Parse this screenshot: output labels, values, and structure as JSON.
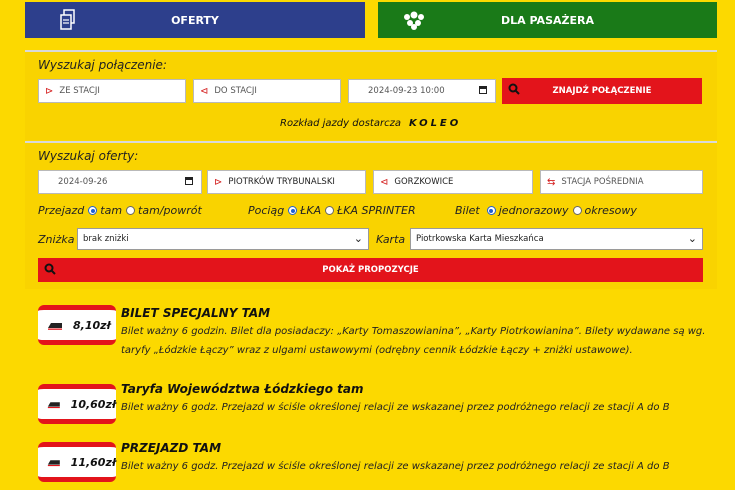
{
  "tabs": [
    {
      "label": "OFERTY",
      "icon": "document-icon"
    },
    {
      "label": "DLA PASAŻERA",
      "icon": "people-group-icon"
    }
  ],
  "connection": {
    "title": "Wyszukaj połączenie:",
    "from_placeholder": "ZE STACJI",
    "to_placeholder": "DO STACJI",
    "datetime": "2024-09-23 10:00",
    "find_label": "ZNAJDŹ POŁĄCZENIE",
    "timetable_text": "Rozkład jazdy dostarcza",
    "provider": "KOLEO"
  },
  "offers_search": {
    "title": "Wyszukaj oferty:",
    "date": "2024-09-26",
    "from": "PIOTRKÓW TRYBUNALSKI",
    "to": "GORZKOWICE",
    "via_placeholder": "STACJA POŚREDNIA",
    "trip": {
      "label": "Przejazd",
      "options": [
        "tam",
        "tam/powrót"
      ],
      "selected": "tam"
    },
    "train": {
      "label": "Pociąg",
      "options": [
        "ŁKA",
        "ŁKA SPRINTER"
      ],
      "selected": "ŁKA"
    },
    "ticket": {
      "label": "Bilet",
      "options": [
        "jednorazowy",
        "okresowy"
      ],
      "selected": "jednorazowy"
    },
    "discount_label": "Zniżka",
    "discount_value": "brak zniżki",
    "card_label": "Karta",
    "card_value": "Piotrkowska Karta Mieszkańca",
    "show_label": "POKAŻ PROPOZYCJE"
  },
  "offers": [
    {
      "price": "8,10zł",
      "title": "BILET SPECJALNY TAM",
      "description": "Bilet ważny 6 godzin. Bilet dla posiadaczy: „Karty Tomaszowianina”, „Karty Piotrkowianina”. Bilety wydawane są wg. taryfy „Łódzkie Łączy” wraz z ulgami ustawowymi (odrębny cennik Łódzkie Łączy + zniżki ustawowe)."
    },
    {
      "price": "10,60zł",
      "title": "Taryfa Województwa Łódzkiego tam",
      "description": "Bilet ważny 6 godz. Przejazd w ściśle określonej relacji ze wskazanej przez podróżnego relacji ze stacji A do B"
    },
    {
      "price": "11,60zł",
      "title": "PRZEJAZD TAM",
      "description": "Bilet ważny 6 godz. Przejazd w ściśle określonej relacji ze wskazanej przez podróżnego relacji ze stacji A do B"
    }
  ],
  "colors": {
    "navy": "#2d3f8c",
    "green": "#1a7a18",
    "red": "#e3141b",
    "yellow": "#fcd900"
  }
}
